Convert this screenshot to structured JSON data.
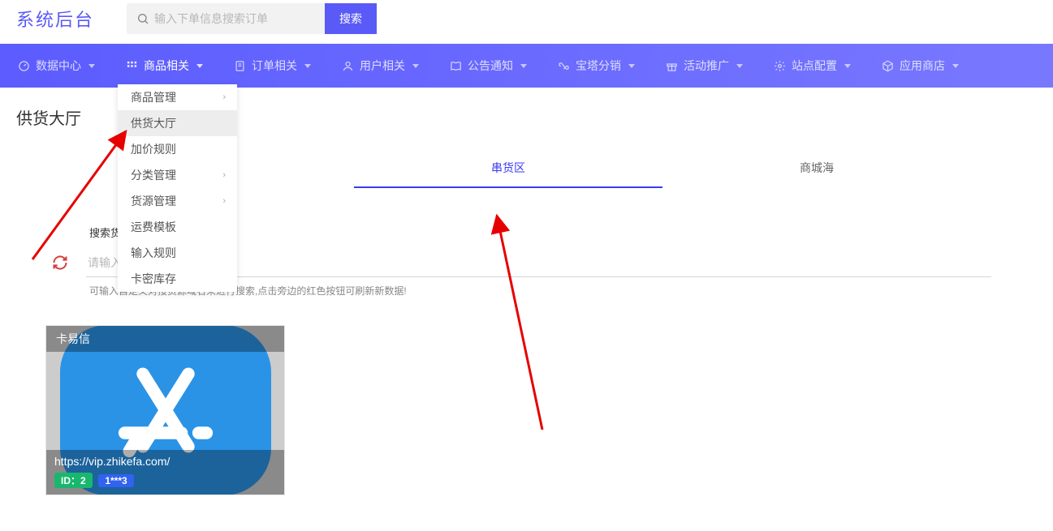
{
  "app": {
    "title": "系统后台"
  },
  "search": {
    "placeholder": "输入下单信息搜索订单",
    "button": "搜索"
  },
  "nav": [
    {
      "icon": "dashboard",
      "label": "数据中心"
    },
    {
      "icon": "grid",
      "label": "商品相关",
      "active": true
    },
    {
      "icon": "order",
      "label": "订单相关"
    },
    {
      "icon": "user",
      "label": "用户相关"
    },
    {
      "icon": "book",
      "label": "公告通知"
    },
    {
      "icon": "infinity",
      "label": "宝塔分销"
    },
    {
      "icon": "gift",
      "label": "活动推广"
    },
    {
      "icon": "gear",
      "label": "站点配置"
    },
    {
      "icon": "cube",
      "label": "应用商店"
    }
  ],
  "dropdown": {
    "items": [
      {
        "label": "商品管理",
        "has_sub": true
      },
      {
        "label": "供货大厅",
        "hover": true
      },
      {
        "label": "加价规则"
      },
      {
        "label": "分类管理",
        "has_sub": true
      },
      {
        "label": "货源管理",
        "has_sub": true
      },
      {
        "label": "运费模板"
      },
      {
        "label": "输入规则"
      },
      {
        "label": "卡密库存"
      }
    ]
  },
  "page": {
    "title": "供货大厅",
    "tabs": [
      {
        "label": "串货区",
        "active": true
      },
      {
        "label": "商城海"
      }
    ],
    "search_label": "搜索货源",
    "source_placeholder": "请输入",
    "hint": "可输入自定义对接货源域名来进行搜索,点击旁边的红色按钮可刷新新数据!"
  },
  "card": {
    "title": "卡易信",
    "url": "https://vip.zhikefa.com/",
    "badge_id": "ID：2",
    "badge_num": "1***3"
  }
}
